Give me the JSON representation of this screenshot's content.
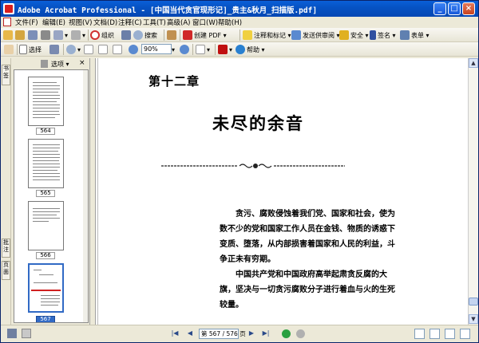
{
  "window": {
    "title": "Adobe Acrobat Professional - [中国当代贪官现形记]_贵主&秋月_扫描版.pdf]",
    "minimize": "_",
    "maximize": "□",
    "close": "×"
  },
  "menu": {
    "items": [
      "文件(F)",
      "编辑(E)",
      "视图(V)",
      "文档(D)",
      "注释(C)",
      "工具(T)",
      "高级(A)",
      "窗口(W)",
      "帮助(H)"
    ]
  },
  "toolbar1": {
    "create_pdf": "创建 PDF",
    "comment": "注释和标记",
    "send": "发送供审阅",
    "secure": "安全",
    "sign": "签名",
    "forms": "表单",
    "organizer_label": "组织",
    "search_label": "搜索"
  },
  "toolbar2": {
    "select": "选择",
    "zoom": "90%",
    "help": "帮助"
  },
  "left_rail": {
    "tab_bookmarks": "书签",
    "tab_comments": "批注",
    "tab_pages": "页面"
  },
  "thumbnail_panel": {
    "options": "选项",
    "close": "×",
    "pages": [
      "564",
      "565",
      "566",
      "567"
    ],
    "selected_page": "567"
  },
  "document": {
    "chapter": "第十二章",
    "title": "未尽的余音",
    "paragraph1": "贪污、腐败侵蚀着我们党、国家和社会，使为数不少的党和国家工作人员在金钱、物质的诱惑下变质、堕落，从内部损害着国家和人民的利益，斗争正未有穷期。",
    "paragraph2": "中国共产党和中国政府高举起肃贪反腐的大旗，坚决与一切贪污腐败分子进行着血与火的生死较量。"
  },
  "statusbar": {
    "page_indicator": "第 567 / 576 页"
  },
  "colors": {
    "titlebar": "#0a5fd8",
    "selection": "#316ac5",
    "desktop": "#3a6ea5"
  }
}
